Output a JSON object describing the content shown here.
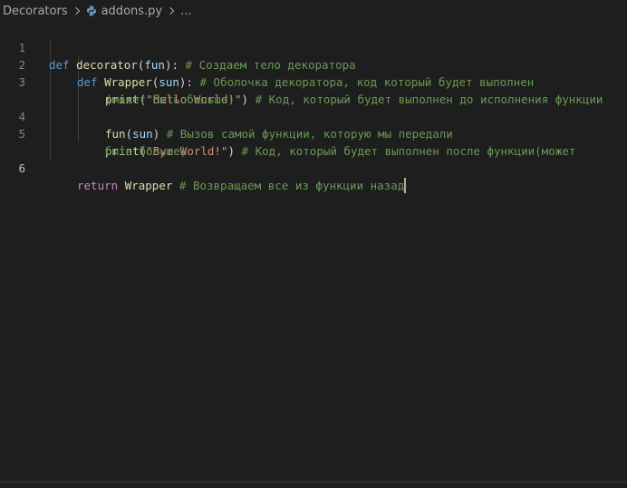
{
  "breadcrumb": {
    "folder": "Decorators",
    "file": "addons.py",
    "file_icon": "python-file-icon"
  },
  "editor": {
    "line_numbers": [
      "1",
      "2",
      "3",
      "4",
      "5",
      "6"
    ],
    "line1": {
      "kw": "def",
      "fn": "decorator",
      "open": "(",
      "param": "fun",
      "close": "):",
      "comment": "# Создаем тело декоратора"
    },
    "line2": {
      "kw": "def",
      "fn": "Wrapper",
      "open": "(",
      "param": "sun",
      "close": "):",
      "comment": "# Оболочка декоратора, код который будет выполнен"
    },
    "line3": {
      "fn": "print",
      "open": "(",
      "str": "\"Hello World!\"",
      "close": ")",
      "comment": "# Код, который будет выполнен до исполнения функции",
      "comment_wrap": "(может быть больше)"
    },
    "line4": {
      "fn": "fun",
      "open": "(",
      "param": "sun",
      "close": ")",
      "comment": "# Вызов самой функции, которую мы передали"
    },
    "line5": {
      "fn": "print",
      "open": "(",
      "str": "\"Bye World!\"",
      "close": ")",
      "comment": "# Код, который будет выполнен после функции(может",
      "comment_wrap": "быть больше)"
    },
    "line6": {
      "kw": "return",
      "name": "Wrapper",
      "comment": "# Возвращаем все из функции назад"
    },
    "active_line": "6"
  },
  "colors": {
    "background": "#1e1e1e",
    "keyword": "#569cd6",
    "control_keyword": "#c586c0",
    "function": "#dcdcaa",
    "parameter": "#9cdcfe",
    "string": "#ce9178",
    "comment": "#6a9955",
    "text": "#d4d4d4",
    "line_number": "#858585"
  }
}
